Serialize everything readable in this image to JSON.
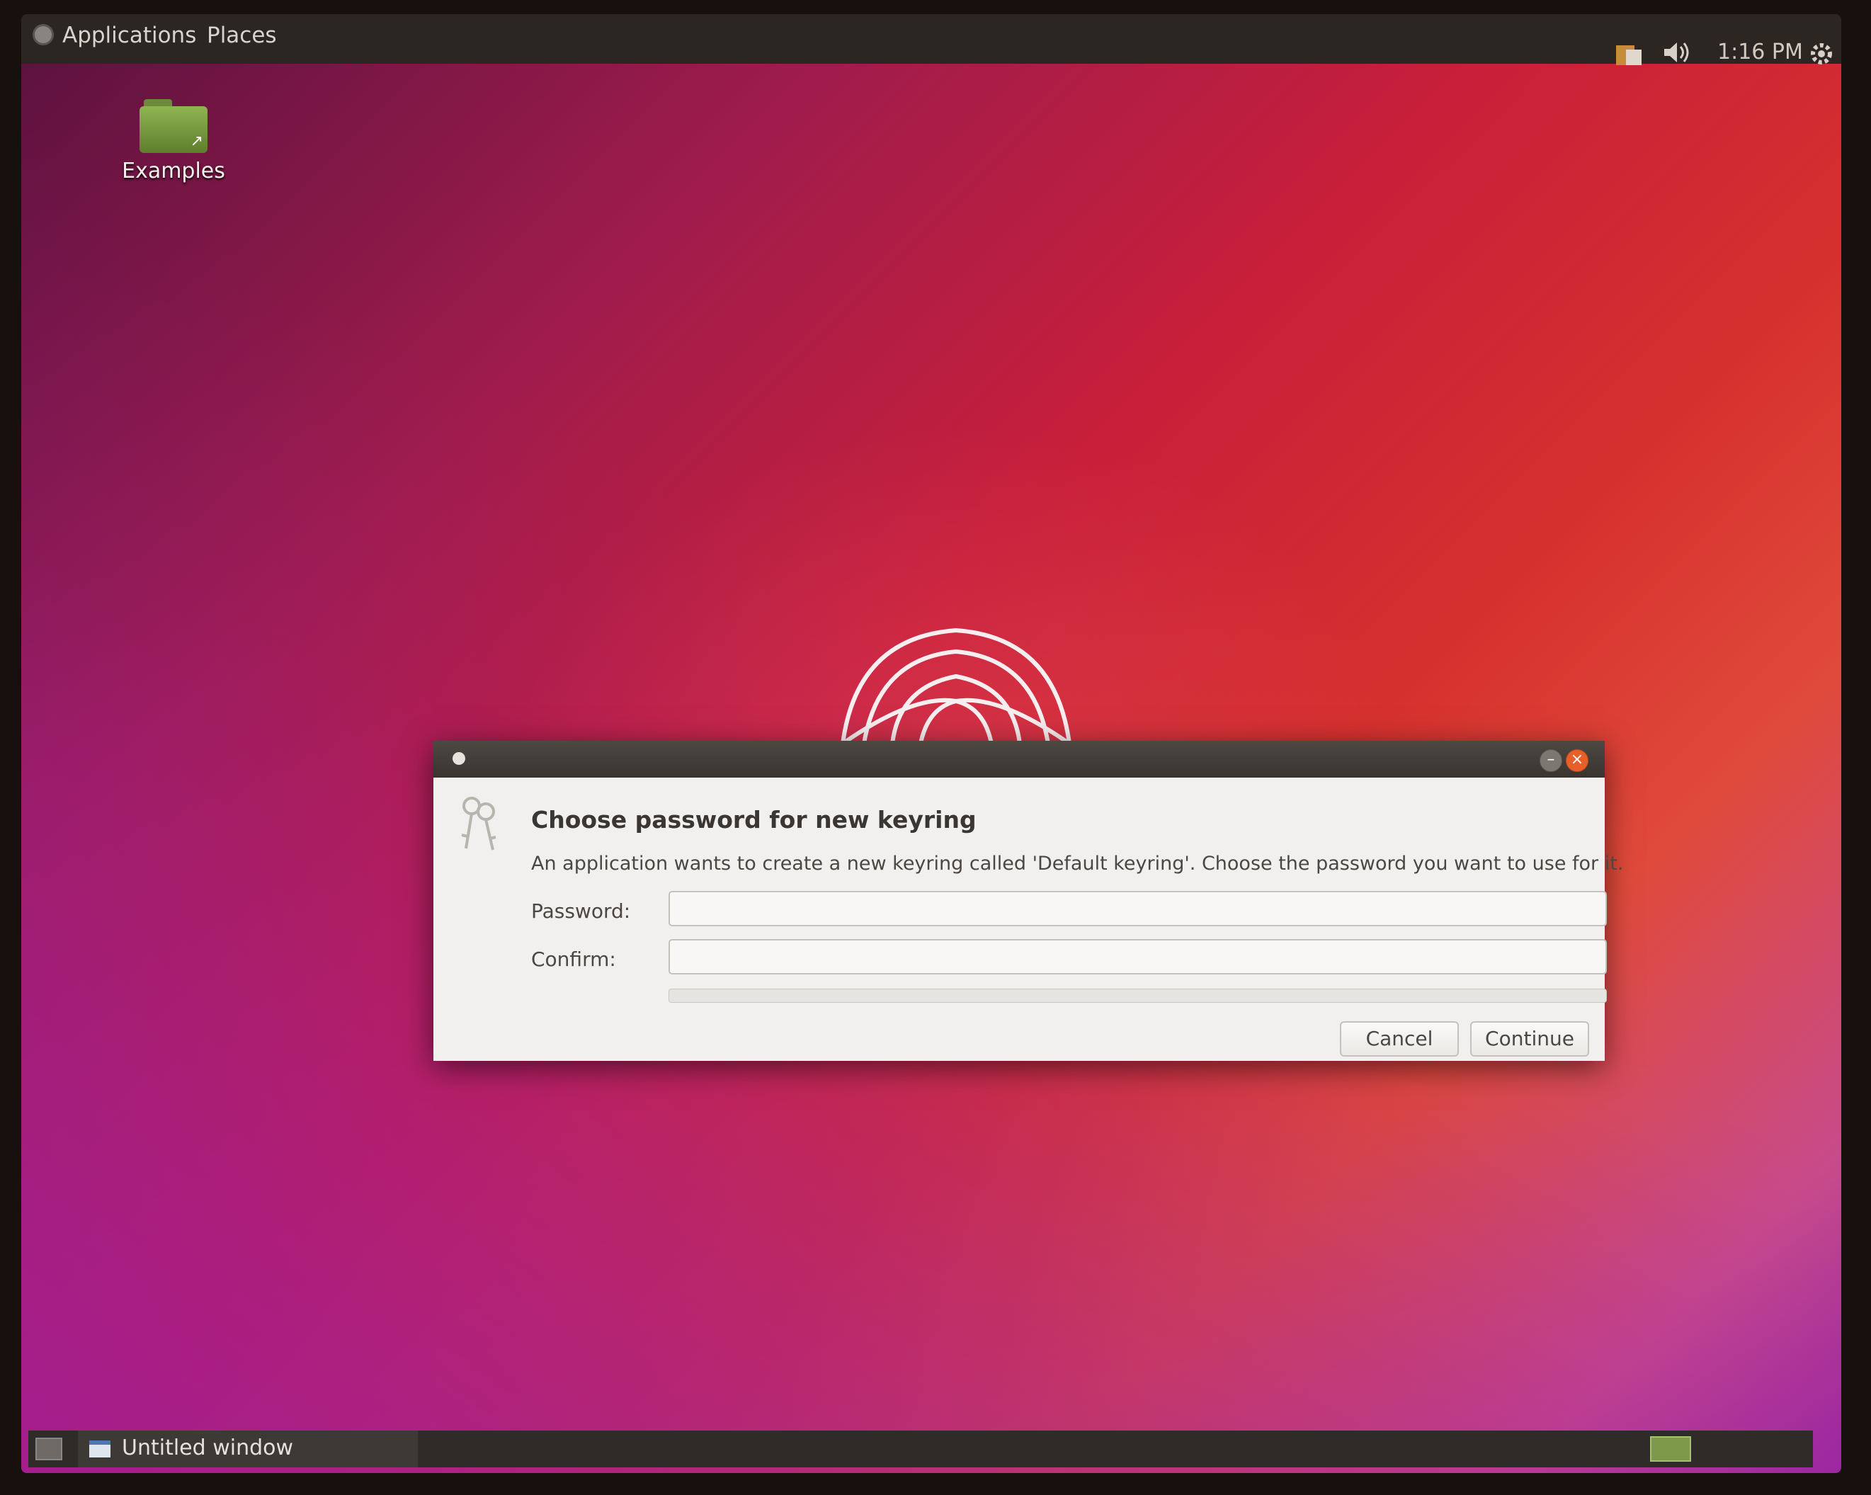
{
  "top_panel": {
    "applications_label": "Applications",
    "places_label": "Places",
    "clock": "1:16 PM"
  },
  "desktop": {
    "icons": [
      {
        "label": "Examples"
      }
    ]
  },
  "dialog": {
    "title": "Choose password for new keyring",
    "description": "An application wants to create a new keyring called 'Default keyring'. Choose the password you want to use for it.",
    "password_label": "Password:",
    "password_value": "",
    "confirm_label": "Confirm:",
    "confirm_value": "",
    "cancel_label": "Cancel",
    "continue_label": "Continue"
  },
  "taskbar": {
    "tasks": [
      {
        "label": "Untitled window"
      }
    ]
  }
}
